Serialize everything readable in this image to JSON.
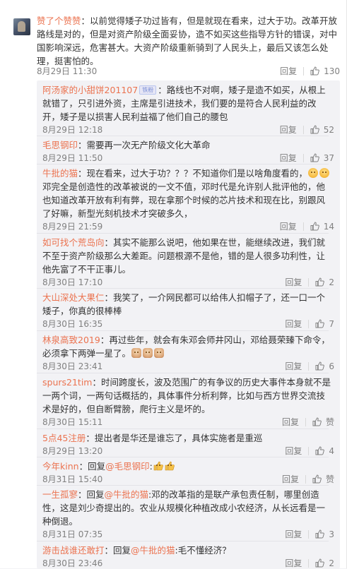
{
  "main_comment": {
    "user": "赞了个赞赞",
    "text": "：以前觉得矮子功过皆有，但是就现在看来，过大于功。改革开放路线是对的，但是对资产阶级全面妥协，造不如买这些指导方针的错误，对中国影响深远，危害甚大。大资产阶级重新骑到了人民头上，最后又该怎么处理，挺害怕的。",
    "time": "8月29日 11:30",
    "reply_label": "回复",
    "likes": "130"
  },
  "replies": [
    {
      "user": "阿汤家的小甜饼201107",
      "badge": "铁粉",
      "text": "：路线也不对啊，矮子是造不如买，从根上就错了，只引进外资，主席是引进技术，我们要的是符合人民利益的改开，矮子是以损害人民利益福了他们自己的腰包",
      "time": "8月29日 12:18",
      "reply_label": "回复",
      "likes": "52"
    },
    {
      "user": "毛思钢印",
      "text": "：需要再一次无产阶级文化大革命",
      "time": "8月29日 11:50",
      "reply_label": "回复",
      "likes": "37"
    },
    {
      "user": "牛批的猫",
      "text": "：现在看来，过大于功？？？不知道你们是以啥角度看的，",
      "text2": "邓完全是创造性的改革被说的一文不值，邓时代是允许别人批评他的，他也知道改革开放有利有弊，现在拿那个时候的芯片技术和现在比，别跟风了好嘛，新型光刻机技术才突破多久，",
      "time": "8月29日 21:59",
      "reply_label": "回复",
      "likes": "14"
    },
    {
      "user": "如可找个荒岛向",
      "text": "：其实不能那么说吧，他如果在世，能继续改进，我们就不至于资产阶级那么大差距。问题根源不是他，错的是人很多功利性，让他先富了不干正事儿。",
      "time": "8月30日 17:10",
      "reply_label": "回复",
      "likes": "2"
    },
    {
      "user": "大山深处大果仁",
      "text": "：我笑了，一介网民都可以给伟人扣帽子了，还一口一个矮子，你真的很棒棒",
      "time": "8月30日 16:35",
      "reply_label": "回复",
      "likes": "7"
    },
    {
      "user": "林泉高致2019",
      "text": "：再过些年，就会有朱邓会师井冈山，邓给聂荣臻下命令，必须拿下两弹一星了。",
      "time": "8月30日 23:41",
      "reply_label": "回复",
      "likes": "6"
    },
    {
      "user": "spurs21tim",
      "text": "：时间跨度长，波及范围广的有争议的历史大事件本身就不是一两个词，一两句话概括的，具体事件分析利弊，比如与西方世界交流技术是好的，但自断臂膀，爬行主义是坏的。",
      "time": "8月30日 15:11",
      "reply_label": "回复",
      "likes": "赞"
    },
    {
      "user": "5点45注册",
      "text": "：提出者是华还是谁忘了，具体实施者是重巡",
      "time": "8月29日 13:20",
      "reply_label": "回复",
      "likes": "4"
    },
    {
      "user": "今年kinn",
      "text_prefix": "：回复",
      "mention": "@毛思钢印",
      "text": ":",
      "time": "8月31日 15:40",
      "reply_label": "回复",
      "likes": "赞"
    },
    {
      "user": "一生孤寥",
      "text_prefix": "：回复",
      "mention": "@牛批的猫",
      "text": ":邓的改革指的是联产承包责任制，哪里创造性，这是刘少奇提出的。农业从规模化种植改成小农经济，从长远看是一种倒退。",
      "time": "8月31日 07:35",
      "reply_label": "回复",
      "likes": "3"
    },
    {
      "user": "游击战谁还敢打",
      "text_prefix": "：回复",
      "mention": "@牛批的猫",
      "text": ":毛不懂经济？",
      "time": "8月30日 23:46",
      "reply_label": "回复",
      "likes": "2"
    }
  ],
  "colors": {
    "username": "#eb7350",
    "meta": "#808080",
    "text": "#333333",
    "reply_bg": "#f2f2f5"
  },
  "icons": {
    "like": "thumbs-up-icon",
    "avatar": "user-avatar"
  }
}
